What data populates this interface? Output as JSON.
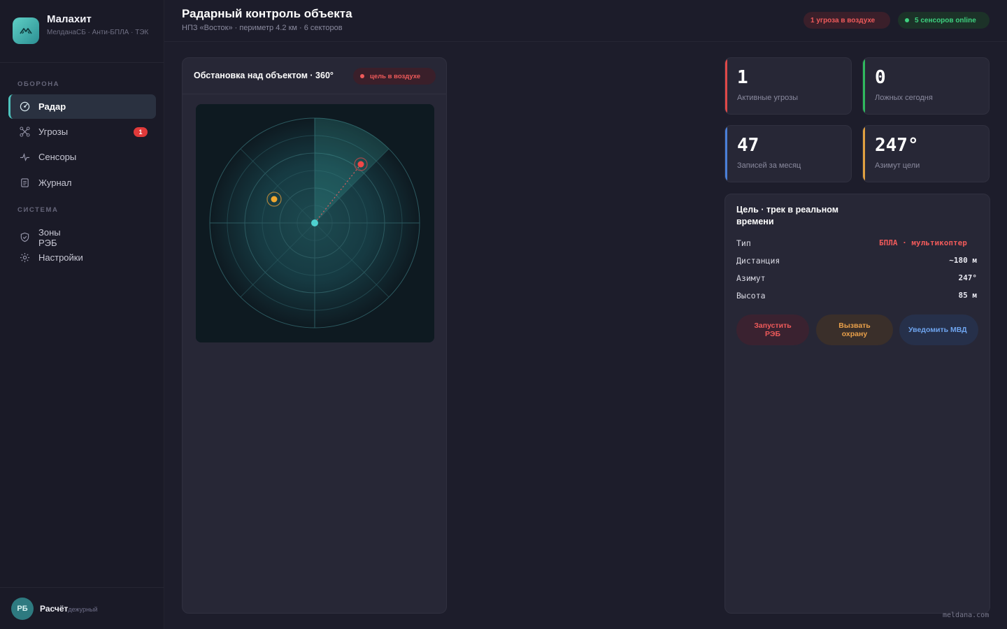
{
  "brand": {
    "title": "Малахит",
    "subtitle": "МелданаСБ · Анти-БПЛА · ТЭК"
  },
  "sidebar": {
    "sections": [
      {
        "label": "ОБОРОНА"
      },
      {
        "label": "СИСТЕМА"
      }
    ],
    "items": [
      {
        "label": "Радар",
        "icon": "radar-icon",
        "active": true
      },
      {
        "label": "Угрозы",
        "icon": "drone-icon",
        "badge": "1"
      },
      {
        "label": "Сенсоры",
        "icon": "pulse-icon"
      },
      {
        "label": "Журнал",
        "icon": "document-icon"
      },
      {
        "label": "Зоны РЭБ",
        "icon": "shield-icon"
      },
      {
        "label": "Настройки",
        "icon": "gear-icon"
      }
    ]
  },
  "user": {
    "initials": "РБ",
    "name": "Расчёт",
    "role": "дежурный"
  },
  "header": {
    "title": "Радарный контроль объекта",
    "subtitle": "НПЗ «Восток» · периметр 4.2 км · 6 секторов",
    "threat_pill": "1 угроза в воздухе",
    "sensor_pill": "5 сенсоров online"
  },
  "radar": {
    "title": "Обстановка над объектом · 360°",
    "status_pill": "цель в воздухе"
  },
  "stats": [
    {
      "value": "1",
      "label": "Активные угрозы",
      "color": "#e04848"
    },
    {
      "value": "0",
      "label": "Ложных сегодня",
      "color": "#2fb85e"
    },
    {
      "value": "47",
      "label": "Записей за месяц",
      "color": "#4a7fd8"
    },
    {
      "value": "247°",
      "label": "Азимут цели",
      "color": "#e0a040"
    }
  ],
  "track": {
    "title": "Цель · трек в реальном времени",
    "rows": [
      {
        "key": "Тип",
        "value": "БПЛА · мультикоптер"
      },
      {
        "key": "Дистанция",
        "value": "~180 м"
      },
      {
        "key": "Азимут",
        "value": "247°"
      },
      {
        "key": "Высота",
        "value": "85 м"
      }
    ],
    "buttons": {
      "reb": "Запустить РЭБ",
      "guard": "Вызвать охрану",
      "mvd": "Уведомить МВД"
    }
  },
  "colors": {
    "accent": "#4ec3bd",
    "danger": "#ef5a5a",
    "ok": "#3ed17f",
    "warn": "#e9a04a",
    "info": "#6ea4ee"
  },
  "watermark": "meldana.com"
}
